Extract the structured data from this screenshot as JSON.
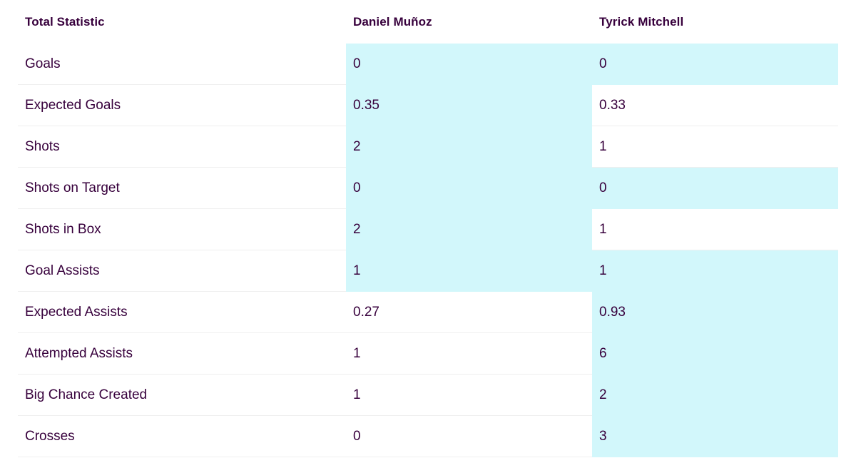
{
  "header": {
    "stat_label": "Total Statistic",
    "player1": "Daniel Muñoz",
    "player2": "Tyrick Mitchell"
  },
  "colors": {
    "highlight": "#d2f7fb",
    "text": "#37003c",
    "divider": "#efefef"
  },
  "rows": [
    {
      "label": "Goals",
      "p1": "0",
      "p2": "0",
      "highlight": [
        "p1",
        "p2"
      ]
    },
    {
      "label": "Expected Goals",
      "p1": "0.35",
      "p2": "0.33",
      "highlight": [
        "p1"
      ]
    },
    {
      "label": "Shots",
      "p1": "2",
      "p2": "1",
      "highlight": [
        "p1"
      ]
    },
    {
      "label": "Shots on Target",
      "p1": "0",
      "p2": "0",
      "highlight": [
        "p1",
        "p2"
      ]
    },
    {
      "label": "Shots in Box",
      "p1": "2",
      "p2": "1",
      "highlight": [
        "p1"
      ]
    },
    {
      "label": "Goal Assists",
      "p1": "1",
      "p2": "1",
      "highlight": [
        "p1",
        "p2"
      ]
    },
    {
      "label": "Expected Assists",
      "p1": "0.27",
      "p2": "0.93",
      "highlight": [
        "p2"
      ]
    },
    {
      "label": "Attempted Assists",
      "p1": "1",
      "p2": "6",
      "highlight": [
        "p2"
      ]
    },
    {
      "label": "Big Chance Created",
      "p1": "1",
      "p2": "2",
      "highlight": [
        "p2"
      ]
    },
    {
      "label": "Crosses",
      "p1": "0",
      "p2": "3",
      "highlight": [
        "p2"
      ]
    }
  ]
}
